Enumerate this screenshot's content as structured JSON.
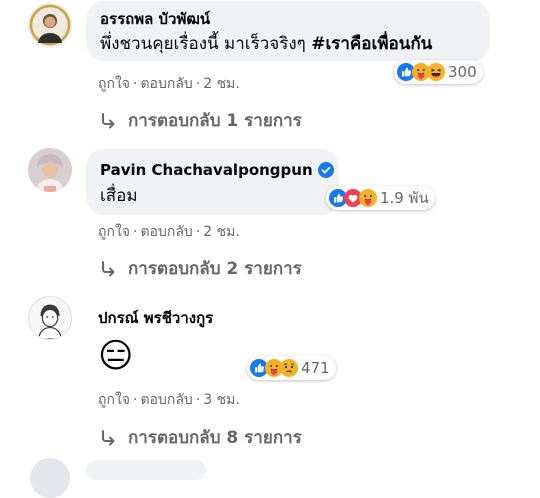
{
  "comments": [
    {
      "author": "อรรถพล บัวพัฒน์",
      "text": "พึ่งชวนคุยเรื่องนี้ มาเร็วจริงๆ ",
      "hashtag": "#เราคือเพื่อนกัน",
      "reactions": [
        "like-icon",
        "care-icon",
        "haha-icon"
      ],
      "reaction_count": "300",
      "like_label": "ถูกใจ",
      "reply_label": "ตอบกลับ",
      "time": "2 ชม.",
      "replies_label": "การตอบกลับ 1 รายการ"
    },
    {
      "author": "Pavin Chachavalpongpun",
      "verified": true,
      "text": "เสื่อม",
      "reactions": [
        "like-icon",
        "love-icon",
        "care-icon"
      ],
      "reaction_count": "1.9 พัน",
      "like_label": "ถูกใจ",
      "reply_label": "ตอบกลับ",
      "time": "2 ชม.",
      "replies_label": "การตอบกลับ 2 รายการ"
    },
    {
      "author": "ปกรณ์ พรชีวางกูร",
      "text": "😑",
      "reactions": [
        "like-icon",
        "care-icon",
        "sad-icon"
      ],
      "reaction_count": "471",
      "like_label": "ถูกใจ",
      "reply_label": "ตอบกลับ",
      "time": "3 ชม.",
      "replies_label": "การตอบกลับ 8 รายการ"
    }
  ],
  "colors": {
    "bubble": "#f0f2f5",
    "like": "#1877f2",
    "love": "#f33e58",
    "care": "#f7b125",
    "meta_text": "#65676b",
    "verified": "#1877f2"
  }
}
